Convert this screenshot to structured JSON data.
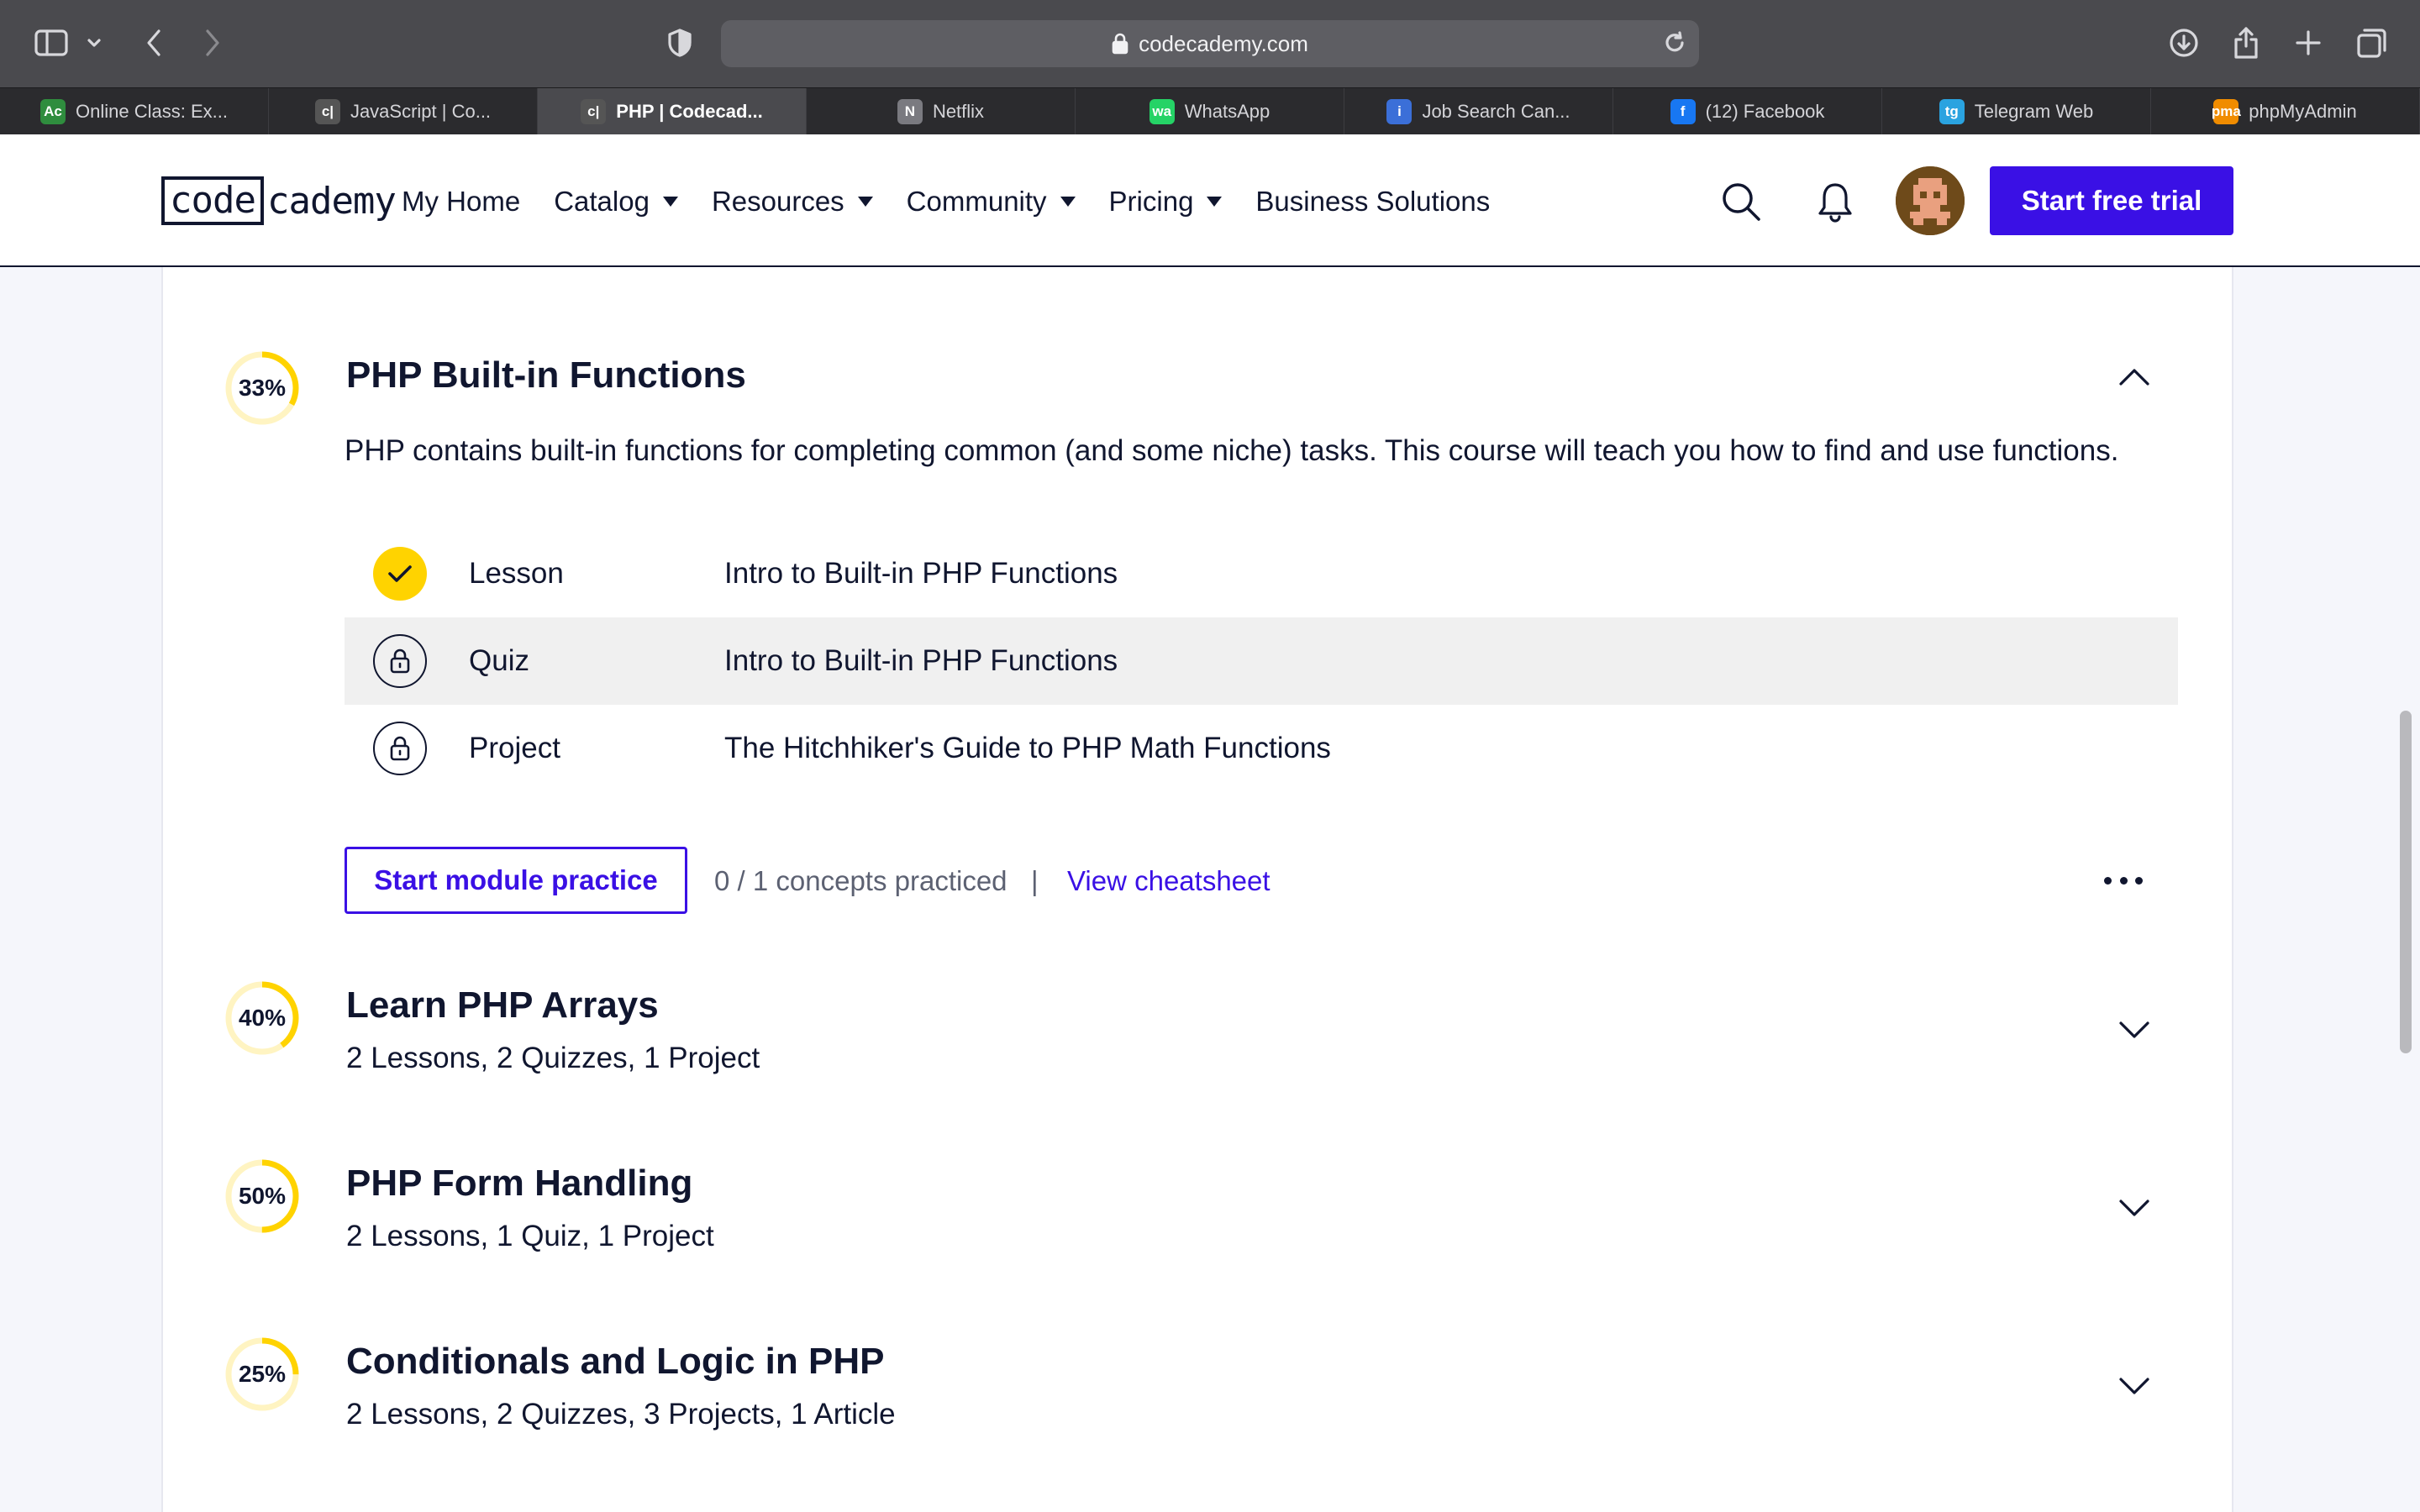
{
  "browser": {
    "url": "codecademy.com",
    "tabs": [
      {
        "label": "Online Class: Ex...",
        "favicon": "Ac",
        "color": "#2f8d3e"
      },
      {
        "label": "JavaScript | Co...",
        "favicon": "c|",
        "color": "#555"
      },
      {
        "label": "PHP | Codecad...",
        "favicon": "c|",
        "color": "#555",
        "active": true
      },
      {
        "label": "Netflix",
        "favicon": "N",
        "color": "#7a7a80"
      },
      {
        "label": "WhatsApp",
        "favicon": "wa",
        "color": "#25d366"
      },
      {
        "label": "Job Search Can...",
        "favicon": "i",
        "color": "#3b6fd8"
      },
      {
        "label": "(12) Facebook",
        "favicon": "f",
        "color": "#1877f2"
      },
      {
        "label": "Telegram Web",
        "favicon": "tg",
        "color": "#2aa3e0"
      },
      {
        "label": "phpMyAdmin",
        "favicon": "pma",
        "color": "#f08c00"
      }
    ]
  },
  "header": {
    "logo": {
      "boxed": "code",
      "rest": "cademy"
    },
    "nav": [
      {
        "label": "My Home",
        "dropdown": false
      },
      {
        "label": "Catalog",
        "dropdown": true
      },
      {
        "label": "Resources",
        "dropdown": true
      },
      {
        "label": "Community",
        "dropdown": true
      },
      {
        "label": "Pricing",
        "dropdown": true
      },
      {
        "label": "Business Solutions",
        "dropdown": false
      }
    ],
    "cta": "Start free trial"
  },
  "modules": [
    {
      "progress": "33%",
      "progress_value": 0.33,
      "title": "PHP Built-in Functions",
      "expanded": true,
      "description": "PHP contains built-in functions for completing common (and some niche) tasks. This course will teach you how to find and use functions.",
      "items": [
        {
          "kind": "Lesson",
          "name": "Intro to Built-in PHP Functions",
          "status": "done"
        },
        {
          "kind": "Quiz",
          "name": "Intro to Built-in PHP Functions",
          "status": "locked",
          "highlighted": true
        },
        {
          "kind": "Project",
          "name": "The Hitchhiker's Guide to PHP Math Functions",
          "status": "locked"
        }
      ],
      "practice_button": "Start module practice",
      "concepts": "0 / 1 concepts practiced",
      "separator": "|",
      "cheatsheet": "View cheatsheet"
    },
    {
      "progress": "40%",
      "progress_value": 0.4,
      "title": "Learn PHP Arrays",
      "summary": "2 Lessons, 2 Quizzes, 1 Project"
    },
    {
      "progress": "50%",
      "progress_value": 0.5,
      "title": "PHP Form Handling",
      "summary": "2 Lessons, 1 Quiz, 1 Project"
    },
    {
      "progress": "25%",
      "progress_value": 0.25,
      "title": "Conditionals and Logic in PHP",
      "summary": "2 Lessons, 2 Quizzes, 3 Projects, 1 Article"
    }
  ],
  "colors": {
    "accent": "#3a10e5",
    "progress": "#ffd300",
    "progress_track": "#fff4c2",
    "ink": "#10162f"
  }
}
